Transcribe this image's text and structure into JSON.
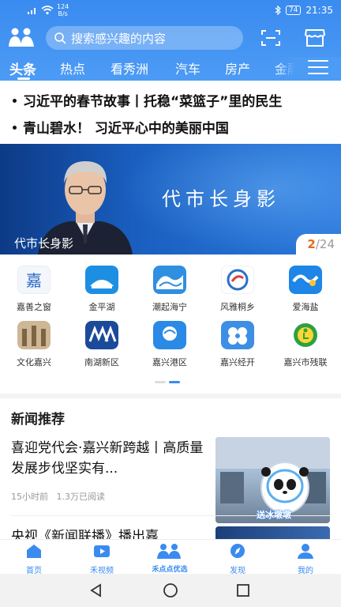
{
  "status_bar": {
    "speed_value": "124",
    "speed_unit": "B/s",
    "battery": "74",
    "time": "21:35"
  },
  "header": {
    "search_placeholder": "搜索感兴趣的内容",
    "tabs": [
      {
        "label": "头条",
        "active": true
      },
      {
        "label": "热点"
      },
      {
        "label": "看秀洲"
      },
      {
        "label": "汽车"
      },
      {
        "label": "房产"
      },
      {
        "label": "金融"
      }
    ],
    "accent_color": "#3a8bf0"
  },
  "headlines": [
    "习近平的春节故事丨托稳“菜篮子”里的民生",
    "青山碧水！ 习近平心中的美丽中国"
  ],
  "banner": {
    "big_text": "代市长身影",
    "caption": "代市长身影",
    "current": "2",
    "separator": "/",
    "total": "24"
  },
  "apps": [
    {
      "label": "嘉善之窗",
      "icon": "jiashan-window-icon"
    },
    {
      "label": "金平湖",
      "icon": "jinpinghu-icon"
    },
    {
      "label": "潮起海宁",
      "icon": "haining-wave-icon"
    },
    {
      "label": "风雅桐乡",
      "icon": "tongxiang-icon"
    },
    {
      "label": "爱海盐",
      "icon": "haiyan-icon"
    },
    {
      "label": "文化嘉兴",
      "icon": "culture-jiaxing-icon"
    },
    {
      "label": "南湖新区",
      "icon": "nanhu-district-icon"
    },
    {
      "label": "嘉兴港区",
      "icon": "jiaxing-port-icon"
    },
    {
      "label": "嘉兴经开",
      "icon": "jiaxing-econ-zone-icon"
    },
    {
      "label": "嘉兴市残联",
      "icon": "disabled-federation-icon"
    }
  ],
  "section": {
    "title": "新闻推荐"
  },
  "news": [
    {
      "title": "喜迎党代会·嘉兴新跨越丨高质量发展步伐坚实有...",
      "time": "15小时前",
      "reads": "1.3万已阅读",
      "thumb_caption": "送冰墩墩"
    },
    {
      "title": "央视《新闻联播》播出嘉"
    }
  ],
  "bottom_nav": [
    {
      "label": "首页",
      "icon": "home-icon"
    },
    {
      "label": "禾视频",
      "icon": "video-icon"
    },
    {
      "label": "禾点点优选",
      "icon": "shopping-icon"
    },
    {
      "label": "发现",
      "icon": "compass-icon"
    },
    {
      "label": "我的",
      "icon": "profile-icon"
    }
  ]
}
